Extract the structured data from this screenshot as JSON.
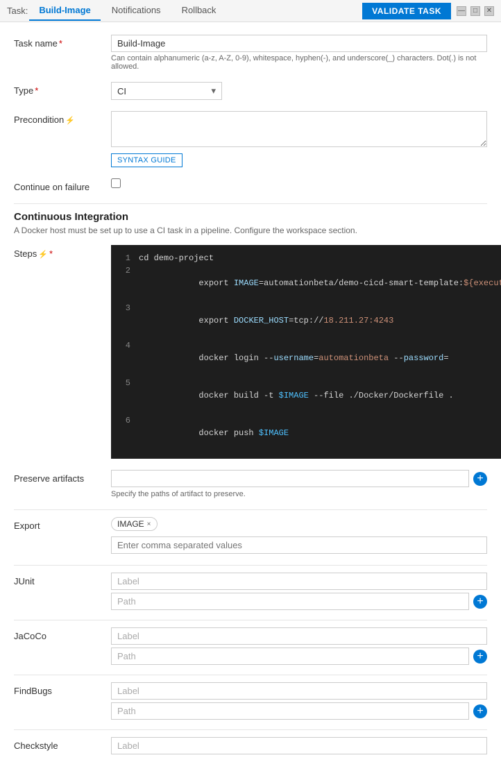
{
  "header": {
    "task_prefix": "Task:",
    "active_tab": "Build-Image",
    "tabs": [
      "Notifications",
      "Rollback"
    ],
    "validate_btn": "VALIDATE TASK"
  },
  "form": {
    "task_name_label": "Task name",
    "task_name_value": "Build-Image",
    "task_name_hint": "Can contain alphanumeric (a-z, A-Z, 0-9), whitespace, hyphen(-), and underscore(_) characters. Dot(.) is not allowed.",
    "type_label": "Type",
    "type_value": "CI",
    "precondition_label": "Precondition",
    "precondition_value": "",
    "syntax_guide_btn": "SYNTAX GUIDE",
    "continue_failure_label": "Continue on failure"
  },
  "ci_section": {
    "title": "Continuous Integration",
    "description": "A Docker host must be set up to use a CI task in a pipeline. Configure the workspace section.",
    "steps_label": "Steps",
    "code_lines": [
      {
        "num": 1,
        "text": "cd demo-project"
      },
      {
        "num": 2,
        "text": "export IMAGE=automationbeta/demo-cicd-smart-template:${executionIndex}"
      },
      {
        "num": 3,
        "text": "export DOCKER_HOST=tcp://18.211.27:4243"
      },
      {
        "num": 4,
        "text": "docker login --username=automationbeta --password="
      },
      {
        "num": 5,
        "text": "docker build -t $IMAGE --file ./Docker/Dockerfile ."
      },
      {
        "num": 6,
        "text": "docker push $IMAGE"
      }
    ]
  },
  "preserve": {
    "label": "Preserve artifacts",
    "placeholder": "",
    "hint": "Specify the paths of artifact to preserve."
  },
  "export": {
    "label": "Export",
    "tag": "IMAGE",
    "input_hint": "Enter comma separated values"
  },
  "junit": {
    "label": "JUnit",
    "label_placeholder": "Label",
    "path_placeholder": "Path"
  },
  "jacoco": {
    "label": "JaCoCo",
    "label_placeholder": "Label",
    "path_placeholder": "Path"
  },
  "findbugs": {
    "label": "FindBugs",
    "label_placeholder": "Label",
    "path_placeholder": "Path"
  },
  "checkstyle": {
    "label": "Checkstyle",
    "label_placeholder": "Label"
  },
  "icons": {
    "plus": "+",
    "close": "×",
    "chevron_down": "▾",
    "minimize": "—",
    "restore": "□",
    "close_win": "✕"
  }
}
